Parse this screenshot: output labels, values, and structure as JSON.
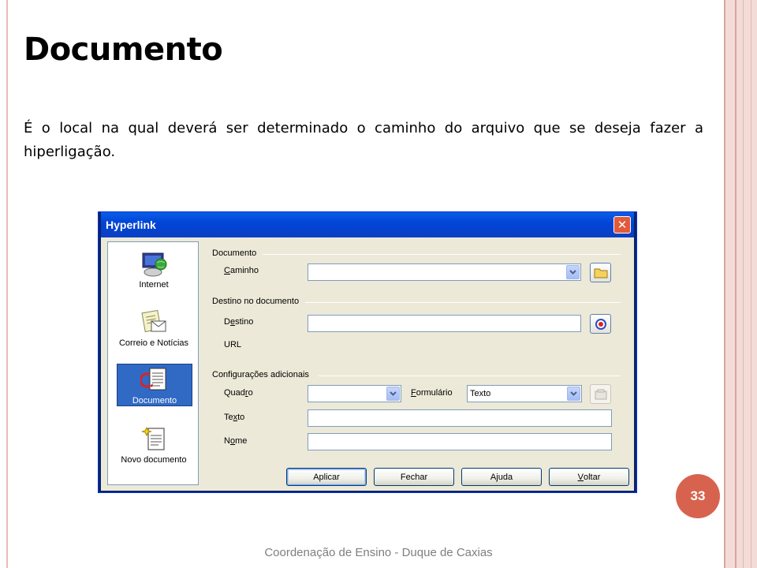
{
  "slide": {
    "title": "Documento",
    "body": "É o local na qual deverá ser determinado  o caminho do arquivo que se deseja fazer a hiperligação.",
    "page_number": "33",
    "footer": "Coordenação de Ensino - Duque de Caxias"
  },
  "dialog": {
    "title": "Hyperlink",
    "close_glyph": "✕",
    "sidebar": [
      {
        "label": "Internet",
        "icon": "internet-icon"
      },
      {
        "label": "Correio e Notícias",
        "icon": "mail-icon"
      },
      {
        "label": "Documento",
        "icon": "document-icon",
        "selected": true
      },
      {
        "label": "Novo documento",
        "icon": "new-document-icon"
      }
    ],
    "group_document": {
      "heading": "Documento",
      "path_label_first": "C",
      "path_label_rest": "aminho",
      "path_value": ""
    },
    "group_target": {
      "heading": "Destino no documento",
      "target_label_first": "D",
      "target_label_u": "e",
      "target_label_rest": "stino",
      "target_value": "",
      "url_label": "URL"
    },
    "group_extra": {
      "heading": "Configurações adicionais",
      "frame_label_a": "Quad",
      "frame_label_u": "r",
      "frame_label_b": "o",
      "frame_value": "",
      "form_label_u": "F",
      "form_label_rest": "ormulário",
      "form_value": "Texto",
      "text_label_a": "Te",
      "text_label_u": "x",
      "text_label_b": "to",
      "text_value": "",
      "name_label_a": "N",
      "name_label_u": "o",
      "name_label_b": "me",
      "name_value": ""
    },
    "buttons": {
      "apply": "Aplicar",
      "close": "Fechar",
      "help_a": "A",
      "help_u": "j",
      "help_b": "uda",
      "back_u": "V",
      "back_rest": "oltar"
    }
  }
}
